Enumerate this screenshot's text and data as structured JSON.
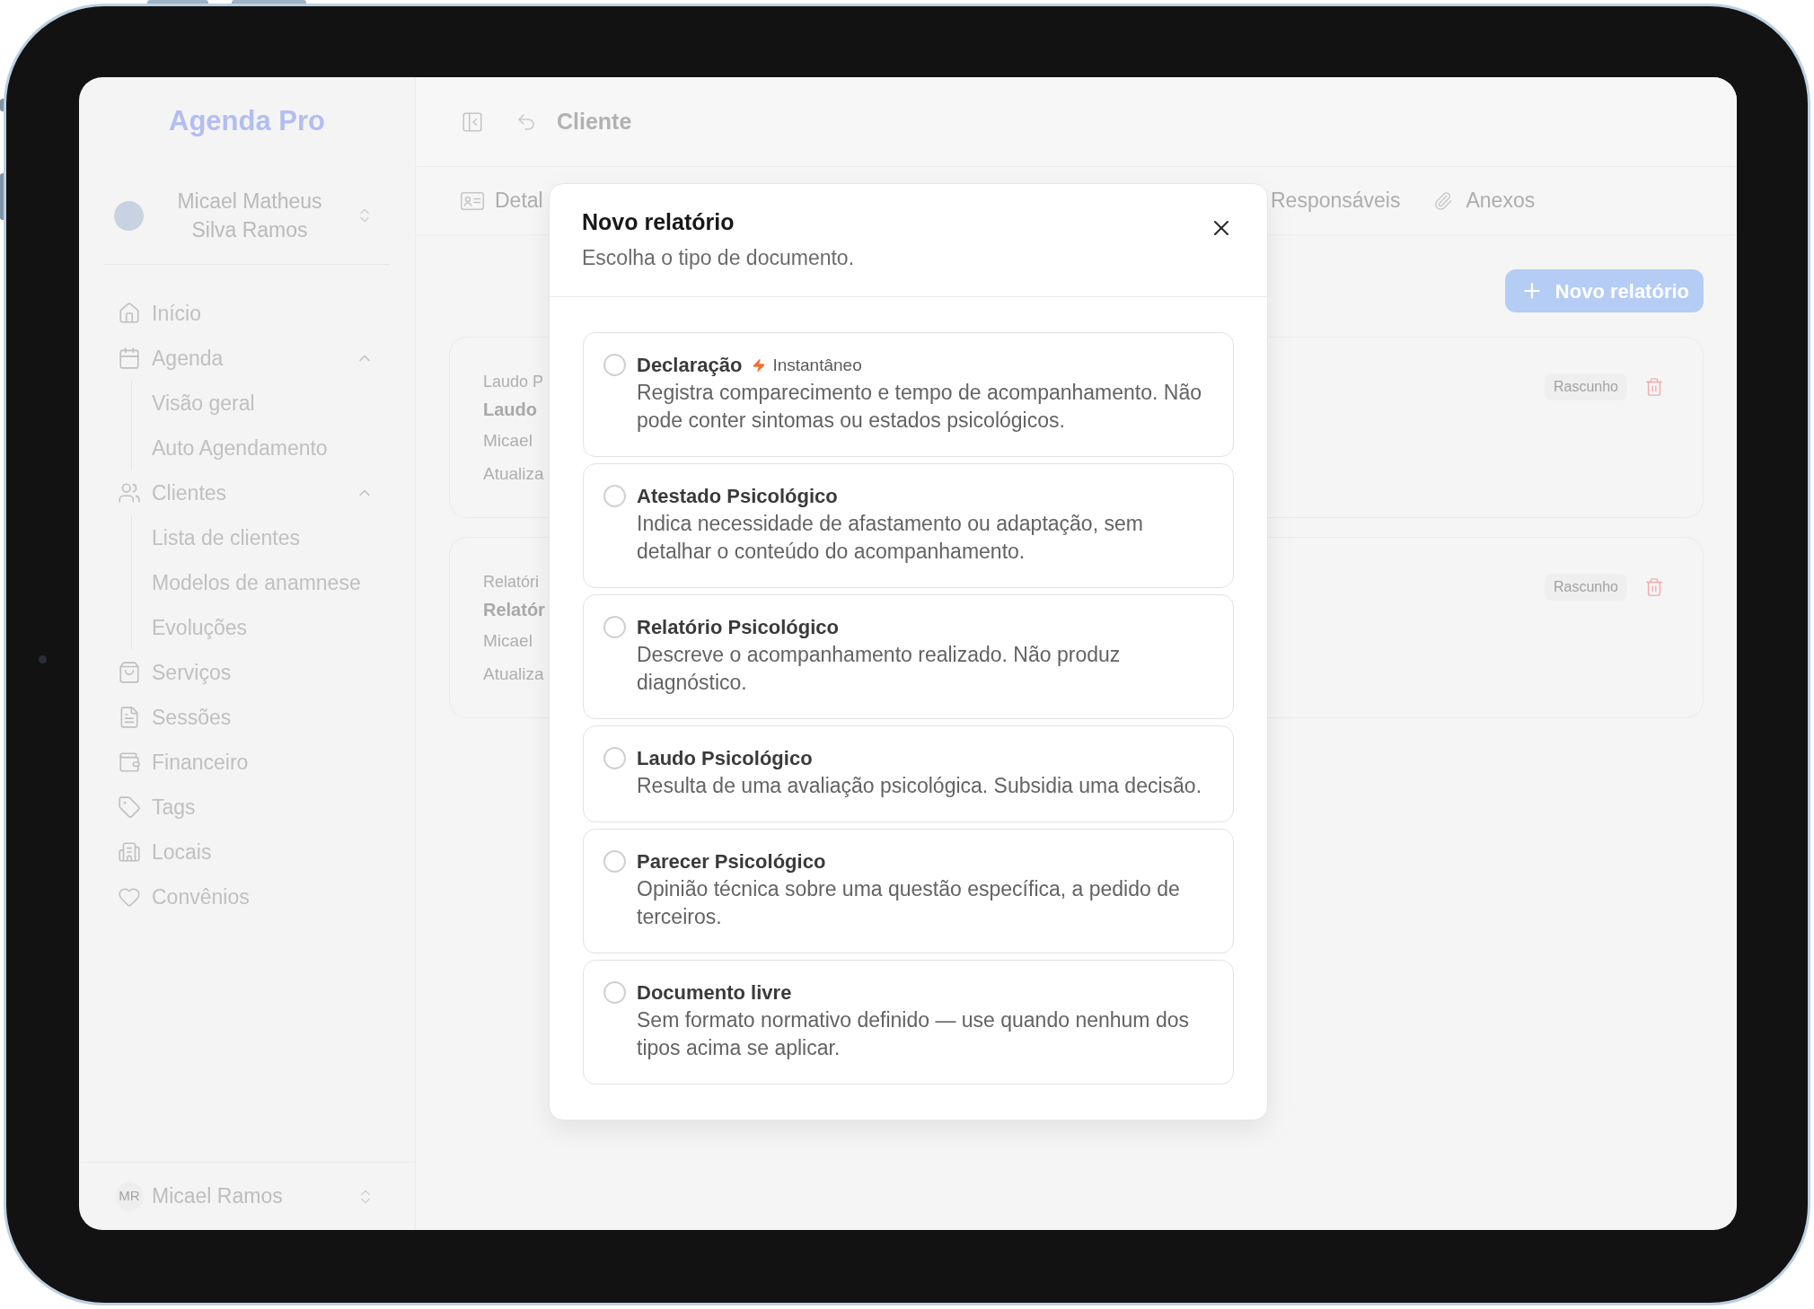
{
  "sidebar": {
    "brand": "Agenda Pro",
    "profile": {
      "name": "Micael Matheus Silva Ramos"
    },
    "nav": [
      {
        "label": "Início"
      },
      {
        "label": "Agenda",
        "expanded": true,
        "children": [
          {
            "label": "Visão geral"
          },
          {
            "label": "Auto Agendamento"
          }
        ]
      },
      {
        "label": "Clientes",
        "expanded": true,
        "children": [
          {
            "label": "Lista de clientes"
          },
          {
            "label": "Modelos de anamnese"
          },
          {
            "label": "Evoluções"
          }
        ]
      },
      {
        "label": "Serviços"
      },
      {
        "label": "Sessões"
      },
      {
        "label": "Financeiro"
      },
      {
        "label": "Tags"
      },
      {
        "label": "Locais"
      },
      {
        "label": "Convênios"
      }
    ],
    "footer_user": {
      "initials": "MR",
      "name": "Micael Ramos"
    }
  },
  "header": {
    "title": "Cliente"
  },
  "tabs": [
    {
      "label": "Detal"
    },
    {
      "label": "Responsáveis"
    },
    {
      "label": "Anexos"
    }
  ],
  "content": {
    "new_button": "Novo relatório",
    "documents": [
      {
        "type": "Laudo P",
        "title": "Laudo",
        "author": "Micael",
        "updated": "Atualiza",
        "status": "Rascunho"
      },
      {
        "type": "Relatóri",
        "title": "Relatór",
        "author": "Micael",
        "updated": "Atualiza",
        "status": "Rascunho"
      }
    ]
  },
  "dialog": {
    "title": "Novo relatório",
    "subtitle": "Escolha o tipo de documento.",
    "options": [
      {
        "title": "Declaração",
        "badge": "Instantâneo",
        "description": "Registra comparecimento e tempo de acompanhamento. Não pode conter sintomas ou estados psicológicos.",
        "selected": false
      },
      {
        "title": "Atestado Psicológico",
        "description": "Indica necessidade de afastamento ou adaptação, sem detalhar o conteúdo do acompanhamento.",
        "selected": false
      },
      {
        "title": "Relatório Psicológico",
        "description": "Descreve o acompanhamento realizado. Não produz diagnóstico.",
        "selected": false
      },
      {
        "title": "Laudo Psicológico",
        "description": "Resulta de uma avaliação psicológica. Subsidia uma decisão.",
        "selected": false
      },
      {
        "title": "Parecer Psicológico",
        "description": "Opinião técnica sobre uma questão específica, a pedido de terceiros.",
        "selected": false
      },
      {
        "title": "Documento livre",
        "description": "Sem formato normativo definido — use quando nenhum dos tipos acima se aplicar.",
        "selected": false
      }
    ]
  }
}
